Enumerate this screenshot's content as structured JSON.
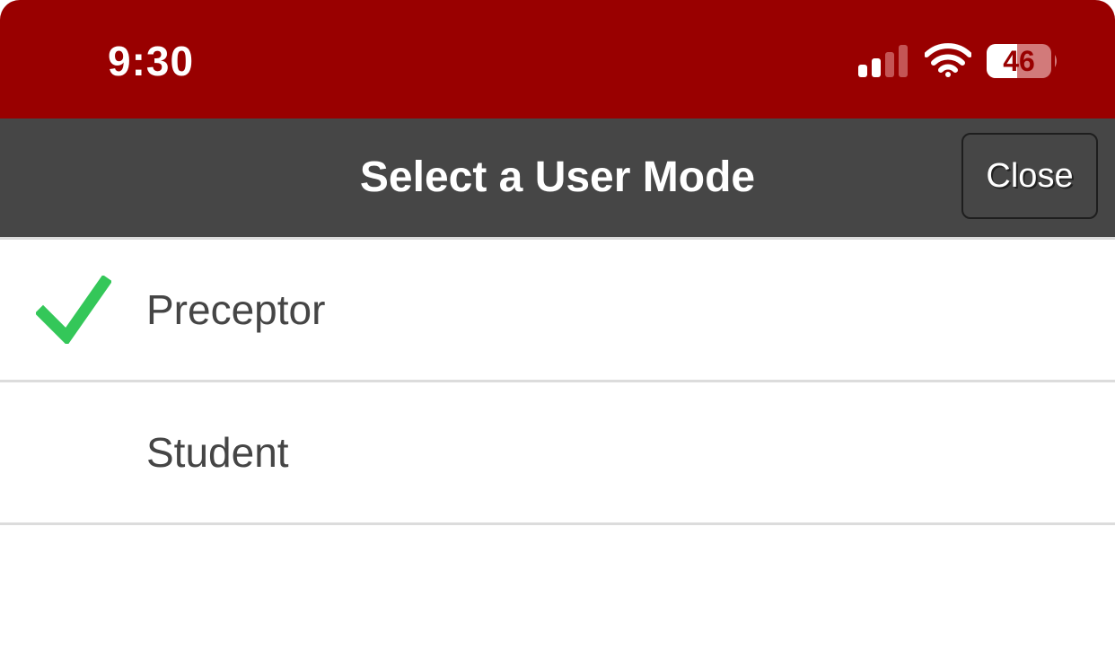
{
  "status_bar": {
    "time": "9:30",
    "battery_level": "46",
    "background_color": "#990000",
    "icons": [
      "signal-icon",
      "wifi-icon",
      "battery-icon"
    ]
  },
  "navbar": {
    "title": "Select a User Mode",
    "close_label": "Close",
    "background_color": "#464646"
  },
  "modes": [
    {
      "label": "Preceptor",
      "selected": true
    },
    {
      "label": "Student",
      "selected": false
    }
  ],
  "colors": {
    "check": "#34C759",
    "divider": "#dcdcdc",
    "text": "#454545"
  }
}
